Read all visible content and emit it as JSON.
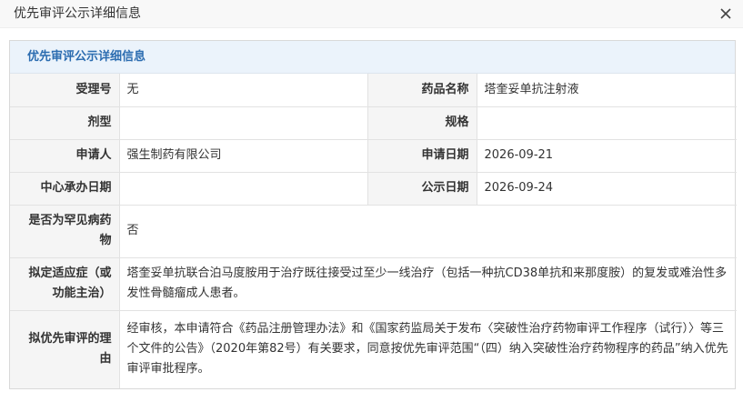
{
  "dialog": {
    "title": "优先审评公示详细信息",
    "close_icon": "close-icon"
  },
  "panel": {
    "heading": "优先审评公示详细信息"
  },
  "fields": {
    "acceptance_no": {
      "label": "受理号",
      "value": "无"
    },
    "drug_name": {
      "label": "药品名称",
      "value": "塔奎妥单抗注射液"
    },
    "dosage_form": {
      "label": "剂型",
      "value": ""
    },
    "specification": {
      "label": "规格",
      "value": ""
    },
    "applicant": {
      "label": "申请人",
      "value": "强生制药有限公司"
    },
    "application_date": {
      "label": "申请日期",
      "value": "2026-09-21"
    },
    "center_date": {
      "label": "中心承办日期",
      "value": ""
    },
    "publication_date": {
      "label": "公示日期",
      "value": "2026-09-24"
    },
    "rare_disease": {
      "label": "是否为罕见病药物",
      "value": "否"
    },
    "indication": {
      "label": "拟定适应症（或功能主治）",
      "value": "塔奎妥单抗联合泊马度胺用于治疗既往接受过至少一线治疗（包括一种抗CD38单抗和来那度胺）的复发或难治性多发性骨髓瘤成人患者。"
    },
    "reason": {
      "label": "拟优先审评的理由",
      "value": "经审核，本申请符合《药品注册管理办法》和《国家药监局关于发布〈突破性治疗药物审评工作程序（试行）〉等三个文件的公告》（2020年第82号）有关要求，同意按优先审评范围“（四）纳入突破性治疗药物程序的药品”纳入优先审评审批程序。"
    }
  }
}
